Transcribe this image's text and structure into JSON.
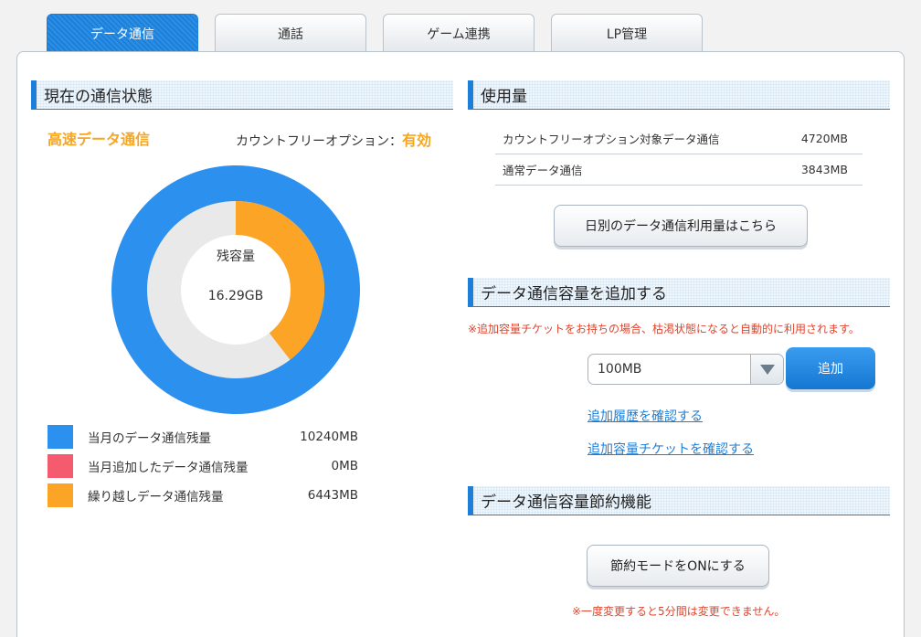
{
  "tabs": [
    {
      "label": "データ通信"
    },
    {
      "label": "通話"
    },
    {
      "label": "ゲーム連携"
    },
    {
      "label": "LP管理"
    }
  ],
  "status": {
    "heading": "現在の通信状態",
    "mode": "高速データ通信",
    "option_label": "カウントフリーオプション：",
    "option_value": "有効",
    "donut": {
      "caption": "残容量",
      "total": "16.29GB",
      "remaining_fraction": 0.395
    },
    "legend": [
      {
        "label": "当月のデータ通信残量",
        "value": "10240MB",
        "color": "#2b90ee"
      },
      {
        "label": "当月追加したデータ通信残量",
        "value": "0MB",
        "color": "#f55b6e"
      },
      {
        "label": "繰り越しデータ通信残量",
        "value": "6443MB",
        "color": "#fca425"
      }
    ]
  },
  "usage": {
    "heading": "使用量",
    "rows": [
      {
        "label": "カウントフリーオプション対象データ通信",
        "value": "4720MB"
      },
      {
        "label": "通常データ通信",
        "value": "3843MB"
      }
    ],
    "daily_button": "日別のデータ通信利用量はこちら"
  },
  "add": {
    "heading": "データ通信容量を追加する",
    "note": "※追加容量チケットをお持ちの場合、枯渇状態になると自動的に利用されます。",
    "selected": "100MB",
    "add_button": "追加",
    "history_link": "追加履歴を確認する",
    "ticket_link": "追加容量チケットを確認する"
  },
  "save": {
    "heading": "データ通信容量節約機能",
    "button": "節約モードをONにする",
    "note": "※一度変更すると5分間は変更できません。"
  },
  "colors": {
    "accent": "#1e7fd8",
    "orange": "#fca425",
    "blue": "#2b90ee",
    "gray": "#e9e9e9"
  }
}
